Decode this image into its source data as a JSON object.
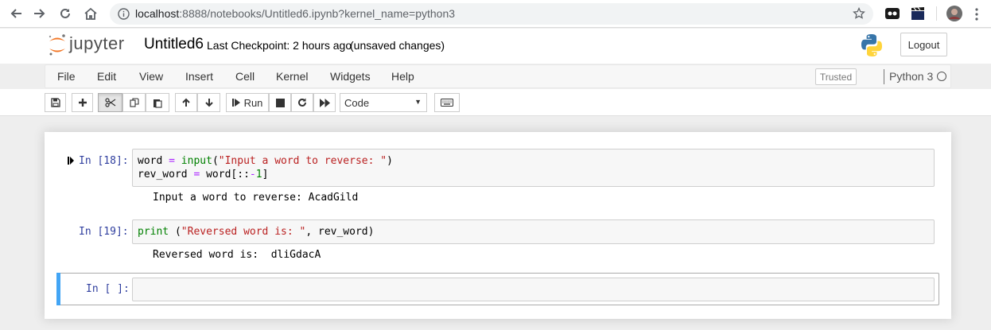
{
  "browser": {
    "url_host": "localhost",
    "url_rest": ":8888/notebooks/Untitled6.ipynb?kernel_name=python3"
  },
  "header": {
    "logo_text": "jupyter",
    "notebook_name": "Untitled6",
    "checkpoint": "Last Checkpoint: 2 hours ago",
    "autosave": "(unsaved changes)",
    "logout": "Logout"
  },
  "menubar": {
    "items": [
      "File",
      "Edit",
      "View",
      "Insert",
      "Cell",
      "Kernel",
      "Widgets",
      "Help"
    ],
    "trusted": "Trusted",
    "kernel": "Python 3"
  },
  "toolbar": {
    "run_label": "Run",
    "cell_type": "Code"
  },
  "cells": [
    {
      "prompt": "In [18]:",
      "code": [
        "word = input(\"Input a word to reverse: \")",
        "rev_word = word[::-1]"
      ],
      "output": "Input a word to reverse: AcadGild"
    },
    {
      "prompt": "In [19]:",
      "code": [
        "print (\"Reversed word is: \", rev_word)"
      ],
      "output": "Reversed word is:  dliGdacA"
    },
    {
      "prompt": "In [ ]:",
      "code": [],
      "output": ""
    }
  ],
  "colors": {
    "prompt": "#303f9f",
    "selected_bar": "#42a5f5",
    "keyword": "#008000",
    "string": "#ba2121",
    "operator": "#aa22ff"
  }
}
